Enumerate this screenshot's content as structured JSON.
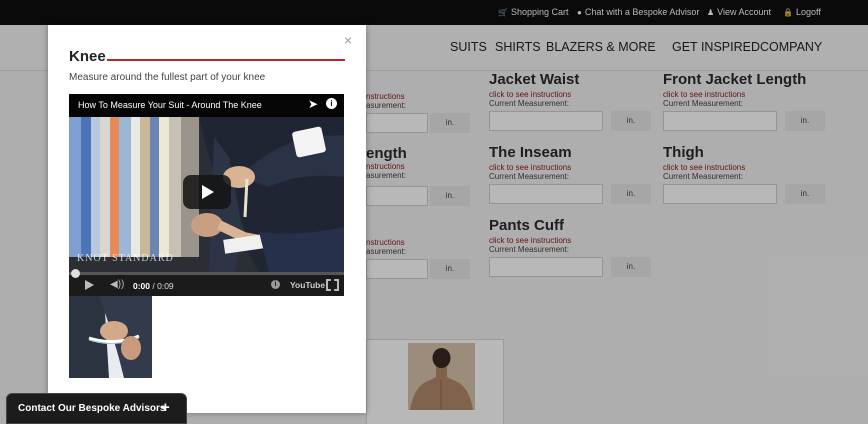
{
  "topbar": {
    "shopping_cart": "Shopping Cart",
    "chat": "Chat with a Bespoke Advisor",
    "view_account": "View Account",
    "logoff": "Logoff"
  },
  "nav": {
    "items": [
      "SUITS",
      "SHIRTS",
      "BLAZERS & MORE",
      "GET INSPIRED",
      "COMPANY"
    ]
  },
  "measurements": {
    "link_text": "click to see instructions",
    "current_label": "Current Measurement:",
    "unit": "in.",
    "fields": [
      {
        "title": "Jacket Waist"
      },
      {
        "title": "Front Jacket Length"
      },
      {
        "title": "The Inseam"
      },
      {
        "title": "Thigh"
      },
      {
        "title": "Pants Cuff"
      }
    ],
    "partial": {
      "row1_link": "nstructions",
      "row1_current": "asurement:",
      "row2_title": "ength",
      "row2_link": "nstructions",
      "row2_current": "asurement:",
      "row3_link": "nstructions",
      "row3_current": "asurement:"
    }
  },
  "modal": {
    "title": "Knee",
    "subtitle": "Measure around the fullest part of your knee",
    "video": {
      "title": "How To Measure Your Suit - Around The Knee",
      "watermark": "KNOT STANDARD",
      "time_current": "0:00",
      "time_total": "/ 0:09",
      "youtube_label": "YouTube",
      "progress_percent": 0
    }
  },
  "advisor": {
    "label": "Contact Our Bespoke Advisors",
    "plus": "+"
  },
  "colors": {
    "accent_red": "#b8262d",
    "link_red": "#8b1a1a",
    "topbar": "#0e0e0e"
  }
}
